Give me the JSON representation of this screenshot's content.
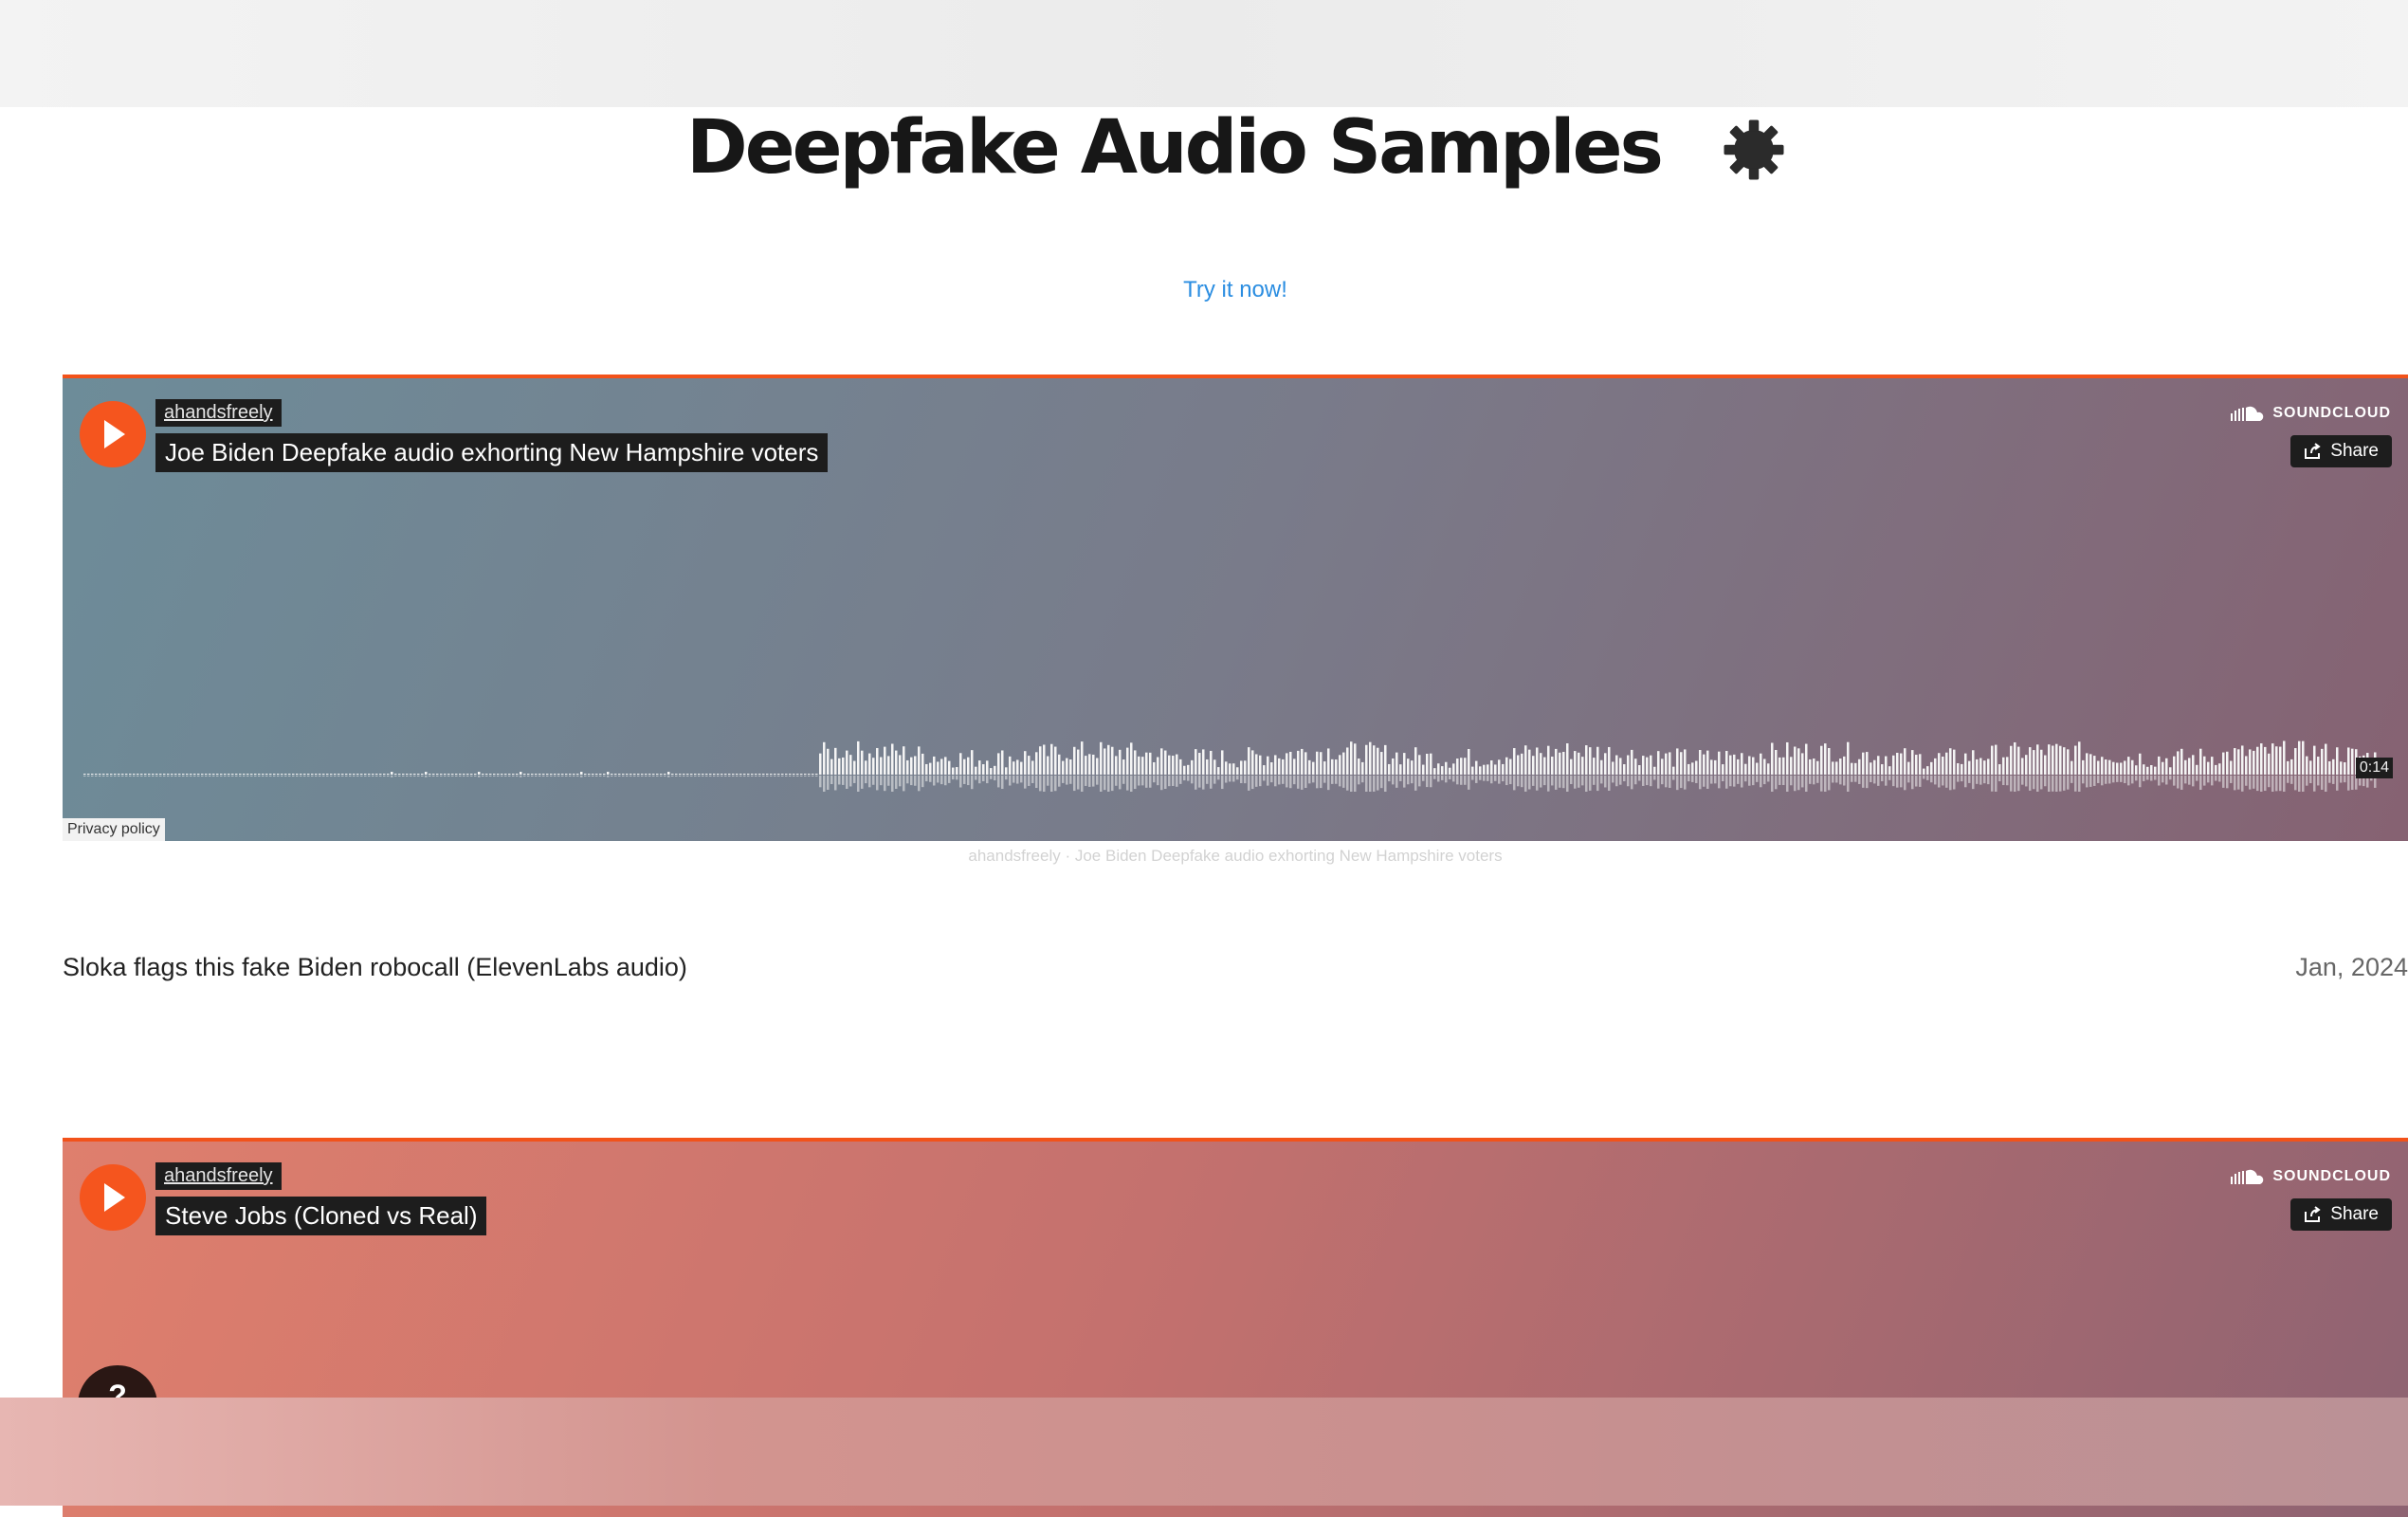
{
  "page": {
    "title": "Deepfake Audio Samples",
    "cta_link": "Try it now!"
  },
  "players": [
    {
      "artist": "ahandsfreely",
      "track": "Joe Biden Deepfake audio exhorting New Hampshire voters",
      "brand": "SOUNDCLOUD",
      "share_label": "Share",
      "duration": "0:14",
      "privacy_label": "Privacy policy",
      "caption": "ahandsfreely · Joe Biden Deepfake audio exhorting New Hampshire voters"
    },
    {
      "artist": "ahandsfreely",
      "track": "Steve Jobs (Cloned vs Real)",
      "brand": "SOUNDCLOUD",
      "share_label": "Share"
    }
  ],
  "sample_info": {
    "description": "Sloka flags this fake Biden robocall (ElevenLabs audio)",
    "date": "Jan, 2024"
  },
  "help": {
    "label": "?"
  },
  "colors": {
    "accent_orange": "#f5551e",
    "link_blue": "#2a8de1",
    "title_dark": "#171717"
  },
  "icons": [
    "gear-icon",
    "play-icon",
    "soundcloud-icon",
    "share-icon"
  ]
}
